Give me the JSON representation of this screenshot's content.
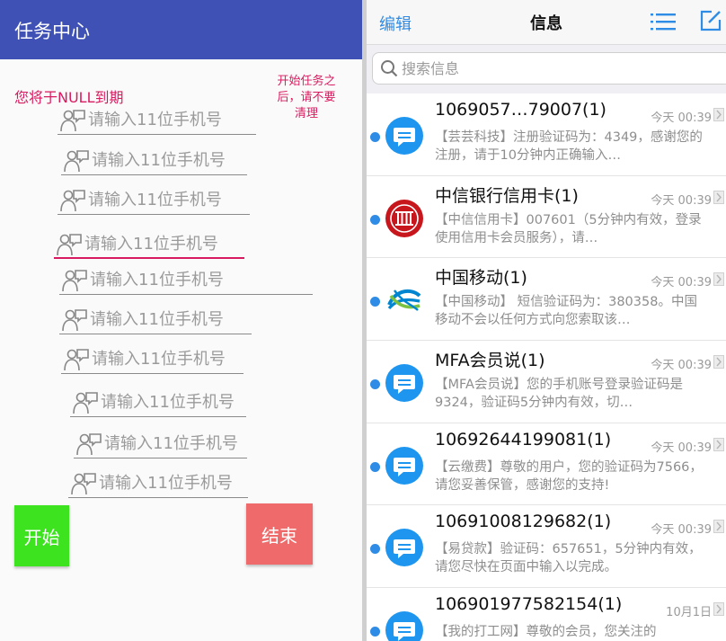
{
  "left": {
    "title": "任务中心",
    "expire_text": "您将于NULL到期",
    "warning_text": "开始任务之后，请不要清理",
    "phone_placeholder": "请输入11位手机号",
    "phone_fields": [
      {
        "value": ""
      },
      {
        "value": ""
      },
      {
        "value": ""
      },
      {
        "value": ""
      },
      {
        "value": ""
      },
      {
        "value": ""
      },
      {
        "value": ""
      },
      {
        "value": ""
      },
      {
        "value": ""
      },
      {
        "value": ""
      }
    ],
    "start_label": "开始",
    "end_label": "结束",
    "colors": {
      "header": "#3f51b5",
      "accent": "#d81b60",
      "start": "#3de31f",
      "end": "#ef6b6b"
    }
  },
  "right": {
    "edit_label": "编辑",
    "title": "信息",
    "search_placeholder": "搜索信息",
    "icons": [
      "list-icon",
      "compose-icon",
      "search-icon",
      "chat-bubble-icon",
      "citic-bank-logo",
      "china-mobile-logo",
      "chevron-right-icon"
    ],
    "messages": [
      {
        "sender": "1069057…79007(1)",
        "time": "今天 00:39",
        "avatar": "chat",
        "preview": "【芸芸科技】注册验证码为：4349，感谢您的注册，请于10分钟内正确输入…"
      },
      {
        "sender": "中信银行信用卡(1)",
        "time": "今天 00:39",
        "avatar": "citic",
        "preview": "【中信信用卡】007601（5分钟内有效，登录使用信用卡会员服务），请…"
      },
      {
        "sender": "中国移动(1)",
        "time": "今天 00:39",
        "avatar": "mobile",
        "preview": "【中国移动】 短信验证码为：380358。中国移动不会以任何方式向您索取该…"
      },
      {
        "sender": "MFA会员说(1)",
        "time": "今天 00:39",
        "avatar": "chat",
        "preview": "【MFA会员说】您的手机账号登录验证码是9324，验证码5分钟内有效，切…"
      },
      {
        "sender": "10692644199081(1)",
        "time": "今天 00:39",
        "avatar": "chat",
        "preview": "【云缴费】尊敬的用户，您的验证码为7566，请您妥善保管，感谢您的支持!"
      },
      {
        "sender": "10691008129682(1)",
        "time": "今天 00:39",
        "avatar": "chat",
        "preview": "【易贷款】验证码：657651，5分钟内有效，请您尽快在页面中输入以完成。"
      },
      {
        "sender": "106901977582154(1)",
        "time": "10月1日",
        "avatar": "chat",
        "preview": "【我的打工网】尊敬的会员，您关注的"
      }
    ],
    "colors": {
      "accent": "#2f8ce6",
      "unread_dot": "#2f8ce6"
    }
  }
}
